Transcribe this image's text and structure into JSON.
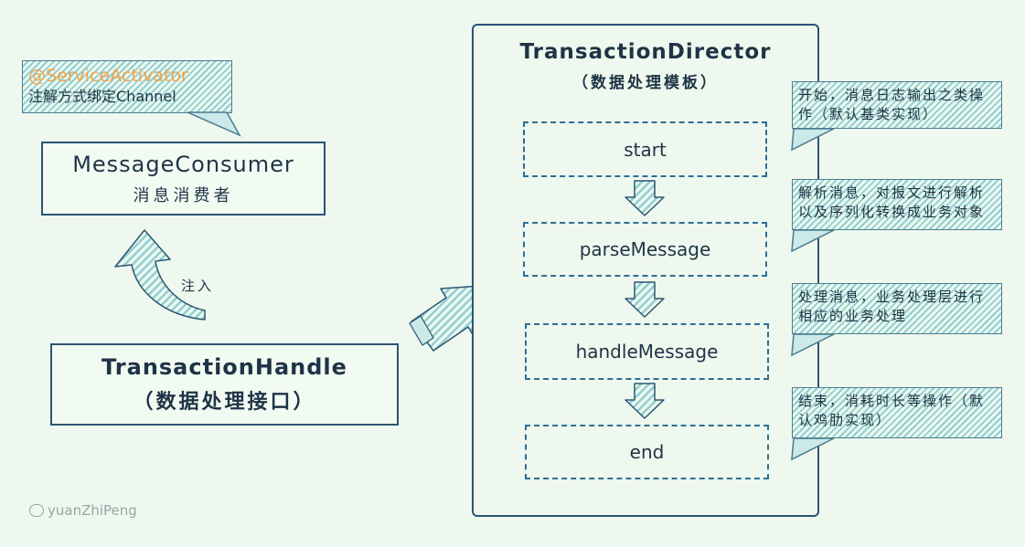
{
  "annotation": {
    "title": "@ServiceActivator",
    "subtitle": "注解方式绑定Channel"
  },
  "consumer": {
    "title": "MessageConsumer",
    "subtitle": "消息消费者"
  },
  "inject_label": "注入",
  "handle": {
    "title": "TransactionHandle",
    "subtitle": "（数据处理接口）"
  },
  "director": {
    "title": "TransactionDirector",
    "subtitle": "（数据处理模板）"
  },
  "steps": [
    {
      "label": "start"
    },
    {
      "label": "parseMessage"
    },
    {
      "label": "handleMessage"
    },
    {
      "label": "end"
    }
  ],
  "notes": [
    {
      "text": "开始，消息日志输出之类操作（默认基类实现）"
    },
    {
      "text": "解析消息，对报文进行解析以及序列化转换成业务对象"
    },
    {
      "text": "处理消息，业务处理层进行相应的业务处理"
    },
    {
      "text": "结束，消耗时长等操作（默认鸡肋实现）"
    }
  ],
  "watermark": "yuanZhiPeng",
  "colors": {
    "accent": "#f0a348",
    "stroke": "#2c5574",
    "hatch": "#8fcfd3",
    "background": "#eef8ee"
  }
}
